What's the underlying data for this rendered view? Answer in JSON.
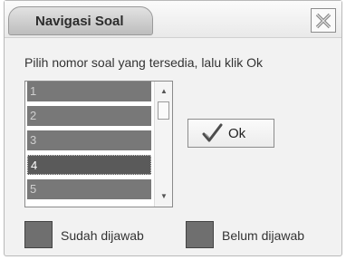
{
  "dialog": {
    "title": "Navigasi Soal",
    "instruction": "Pilih nomor soal yang tersedia, lalu klik Ok"
  },
  "question_list": {
    "items": [
      "1",
      "2",
      "3",
      "4",
      "5"
    ],
    "selected": "4"
  },
  "buttons": {
    "ok_label": "Ok"
  },
  "legend": {
    "answered_label": "Sudah dijawab",
    "unanswered_label": "Belum dijawab"
  },
  "icons": {
    "close": "close-x-icon",
    "ok": "checkmark-icon"
  },
  "colors": {
    "item_background": "#787878",
    "selected_item_background": "#5a5a5a",
    "answered_swatch": "#6f6f6f",
    "unanswered_swatch": "#6f6f6f"
  }
}
